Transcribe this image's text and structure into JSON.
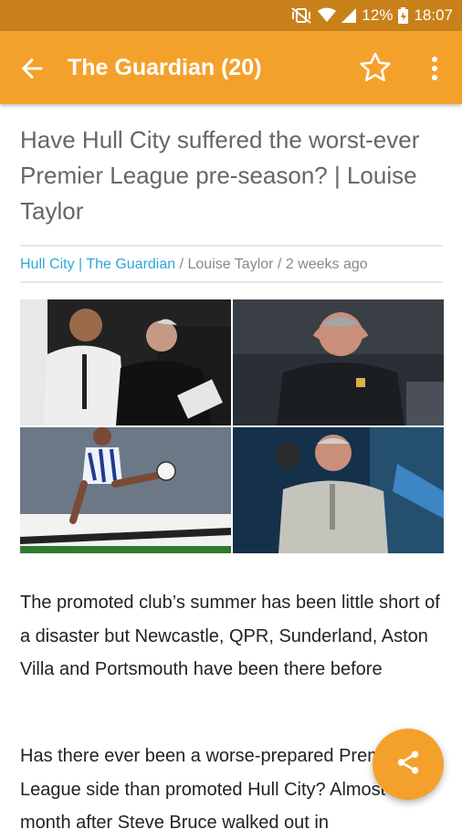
{
  "status_bar": {
    "battery": "12%",
    "time": "18:07",
    "icons": [
      "mute-vibrate-icon",
      "wifi-icon",
      "signal-icon",
      "battery-charging-icon"
    ]
  },
  "app_bar": {
    "title": "The Guardian (20)",
    "icons": [
      "arrow-back-icon",
      "star-outline-icon",
      "more-vert-icon"
    ]
  },
  "article": {
    "headline": "Have Hull City suffered the worst-ever Premier League pre-season? | Louise Taylor",
    "meta": {
      "source_link": "Hull City | The Guardian",
      "separator": " / ",
      "author": "Louise Taylor",
      "time_ago": "2 weeks ago"
    },
    "paragraphs": [
      "The promoted club’s summer has been little short of a disaster but Newcastle, QPR, Sunderland, Aston Villa and Portsmouth have been there before",
      "Has there ever been a worse-prepared Premier League side than promoted Hull City? Almost a month after Steve Bruce walked out in"
    ]
  },
  "fab": {
    "icon": "share-icon"
  },
  "colors": {
    "primary": "#f4a12c",
    "status_bar": "#c8811a",
    "link": "#2ca8d8"
  }
}
